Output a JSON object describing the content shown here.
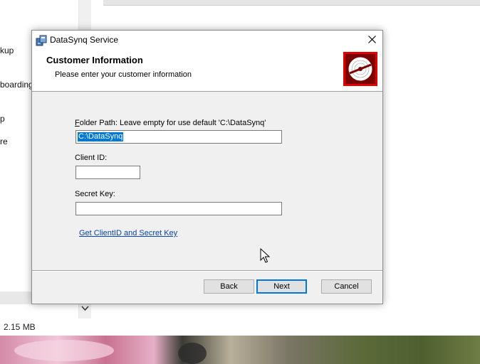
{
  "background": {
    "nav_items": [
      "kup",
      "boarding",
      "p",
      "re"
    ],
    "status_size": "2.15 MB"
  },
  "dialog": {
    "title": "DataSynq Service",
    "header_title": "Customer Information",
    "header_subtitle": "Please enter your customer information",
    "folder": {
      "label_accel": "F",
      "label_rest": "older Path: Leave empty for use default 'C:\\DataSynq'",
      "value": "C:\\DataSynq",
      "value_selected": true
    },
    "client_id": {
      "label": "Client ID:",
      "value": ""
    },
    "secret_key": {
      "label": "Secret Key:",
      "value": ""
    },
    "help_link": "Get ClientID and Secret Key",
    "buttons": {
      "back": "Back",
      "next": "Next",
      "cancel": "Cancel"
    },
    "close_glyph": "✕"
  },
  "colors": {
    "selection": "#0078d7",
    "logo_red": "#8b0000",
    "link": "#0645ad"
  },
  "icons": [
    "installer-icon",
    "close-icon",
    "disc-logo-icon",
    "chevron-down-icon",
    "mouse-cursor-icon"
  ]
}
